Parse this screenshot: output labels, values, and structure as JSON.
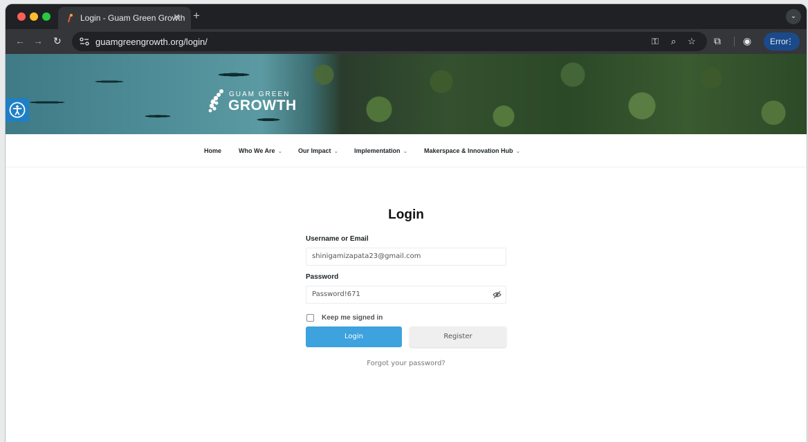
{
  "browser": {
    "tab_title": "Login - Guam Green Growth",
    "tab_close": "✕",
    "new_tab": "+",
    "url": "guamgreengrowth.org/login/",
    "error_label": "Error"
  },
  "site": {
    "logo_line1": "GUAM GREEN",
    "logo_line2": "GROWTH",
    "nav": [
      {
        "label": "Home"
      },
      {
        "label": "Who We Are"
      },
      {
        "label": "Our Impact"
      },
      {
        "label": "Implementation"
      },
      {
        "label": "Makerspace & Innovation Hub"
      }
    ]
  },
  "login": {
    "title": "Login",
    "username_label": "Username or Email",
    "username_value": "shinigamizapata23@gmail.com",
    "password_label": "Password",
    "password_value": "Password!671",
    "keep_signed_in_label": "Keep me signed in",
    "keep_signed_in_checked": false,
    "login_button": "Login",
    "register_button": "Register",
    "forgot_link": "Forgot your password?"
  },
  "colors": {
    "accent": "#3da2dd",
    "error_chip": "#1a4a8a",
    "accessibility_button": "#1f7fc5"
  }
}
